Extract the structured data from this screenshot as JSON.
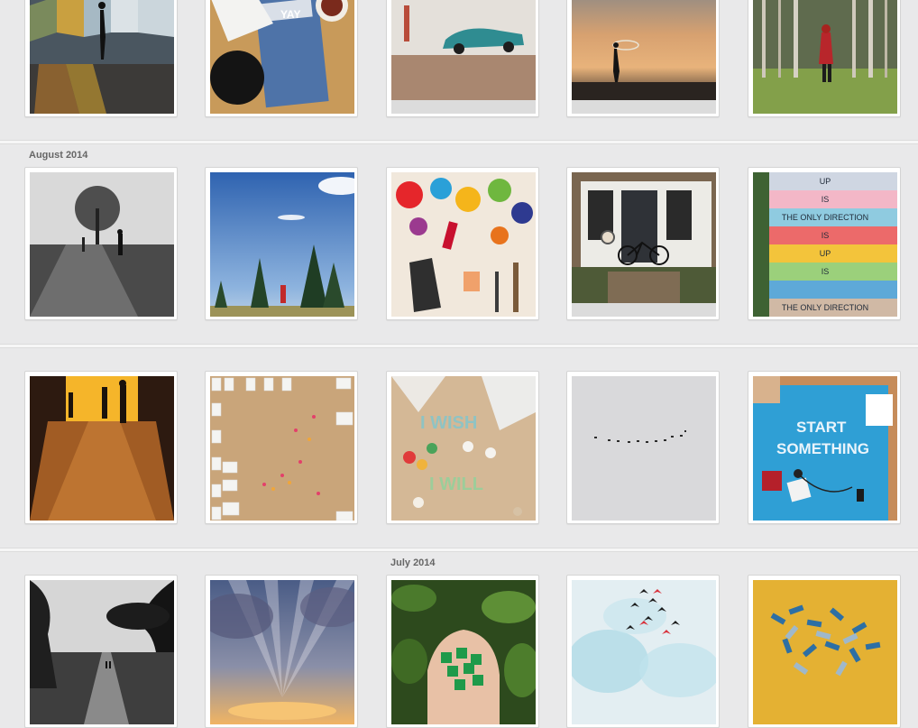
{
  "months": [
    {
      "label": "August 2014"
    },
    {
      "label": "July 2014"
    }
  ],
  "photo_descriptions": {
    "r0": [
      "glass-wall-silhouette",
      "newspaper-coffee-yarn",
      "vintage-car-beach",
      "hula-hoop-sunset",
      "red-coat-forest"
    ],
    "r1": [
      "bw-tree-walk",
      "pine-trees-blue-sky",
      "paint-palette",
      "house-bicycle",
      "stairs-up-is-the-only-direction"
    ],
    "r2": [
      "tunnel-shadows",
      "polaroid-wall",
      "i-wish-i-will-letters",
      "birds-minimal-sky",
      "start-something-blue-paper"
    ],
    "r3": [
      "bw-cypress-road",
      "sunray-clouds",
      "dice-in-hand",
      "paper-birds",
      "blue-rolled-paper"
    ]
  },
  "texts": {
    "stairs_lines": [
      "UP",
      "IS",
      "THE ONLY DIRECTION",
      "IS",
      "UP",
      "IS",
      "THE ONLY DIRECTION"
    ],
    "wish_word": "I WISH",
    "will_word": "I WILL",
    "start_word": "START",
    "something_word": "SOMETHING",
    "newspaper_word": "YAY"
  }
}
